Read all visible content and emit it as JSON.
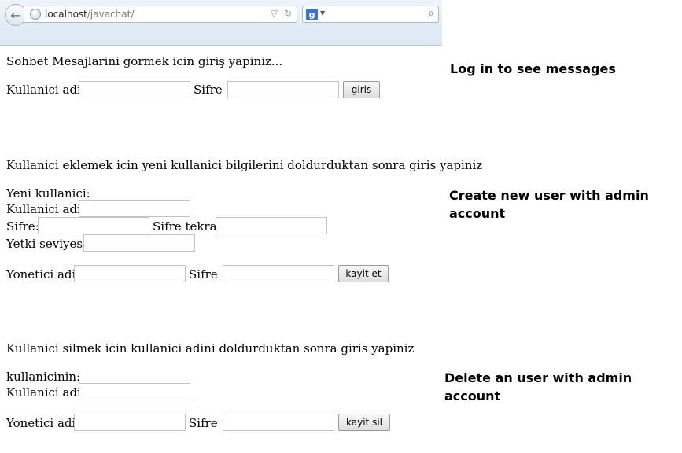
{
  "browser": {
    "url_host": "localhost",
    "url_path": "/javachat/",
    "search_engine_label": "g"
  },
  "login": {
    "intro": "Sohbet Mesajlarini gormek icin giriş yapiniz...",
    "username_label": "Kullanici adi:",
    "password_label": "Sifre :",
    "button": "giris"
  },
  "add_user": {
    "intro": "Kullanici eklemek icin yeni kullanici bilgilerini doldurduktan sonra giris yapiniz",
    "section_label": "Yeni kullanici:",
    "username_label": "Kullanici adi:",
    "password_label": "Sifre:",
    "password_repeat_label": "Sifre tekrar:",
    "level_label": "Yetki seviyesi:",
    "admin_label": "Yonetici adi:",
    "admin_password_label": "Sifre :",
    "button": "kayit et"
  },
  "delete_user": {
    "intro": "Kullanici silmek icin kullanici adini doldurduktan sonra giris yapiniz",
    "section_label": "kullanicinin:",
    "username_label": "Kullanici adi:",
    "admin_label": "Yonetici adi:",
    "admin_password_label": "Sifre :",
    "button": "kayit sil"
  },
  "annotations": {
    "login": "Log in to see messages",
    "create_line1": "Create new user with admin",
    "create_line2": "account",
    "delete_line1": "Delete an user with admin",
    "delete_line2": "account"
  }
}
